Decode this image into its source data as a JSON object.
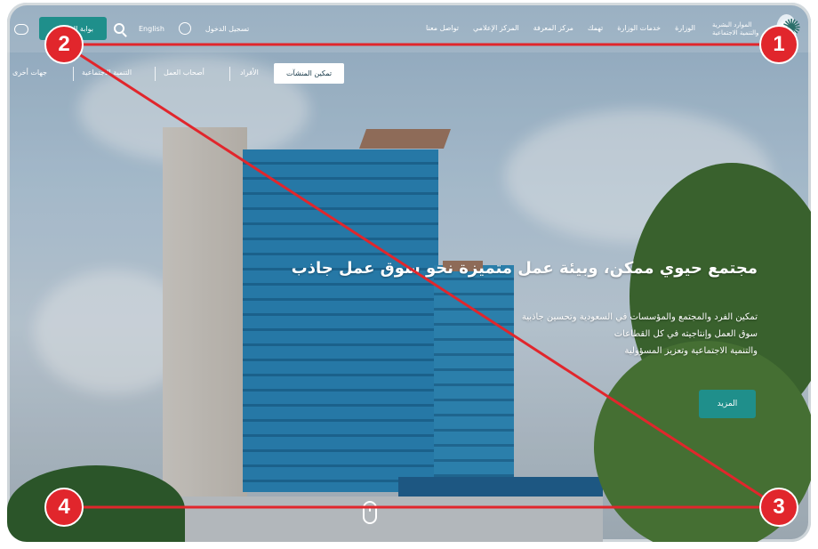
{
  "header": {
    "logo_text": "الموارد البشرية والتنمية الاجتماعية",
    "nav_items": [
      "الوزارة",
      "خدمات الوزارة",
      "تهمك",
      "مركز المعرفة",
      "المركز الإعلامي",
      "تواصل معنا"
    ],
    "language_label": "English",
    "login_label": "تسجيل الدخول",
    "top_cta_label": "بوابة الخدمات"
  },
  "subnav": {
    "active_label": "تمكين المنشآت",
    "items": [
      "الأفراد",
      "أصحاب العمل",
      "التنمية الاجتماعية",
      "جهات أخرى"
    ]
  },
  "hero": {
    "title": "مجتمع حيوي ممكن، وبيئة عمل متميزة نحو سوق عمل جاذب",
    "desc_lines": [
      "تمكين الفرد والمجتمع والمؤسسات في السعودية وتحسين جاذبية",
      "سوق العمل وإنتاجيته في كل القطاعات",
      "والتنمية الاجتماعية وتعزيز المسؤولية"
    ],
    "cta_label": "المزيد"
  },
  "annotations": {
    "marker_color": "#e1262c",
    "markers": [
      "1",
      "2",
      "3",
      "4"
    ]
  }
}
